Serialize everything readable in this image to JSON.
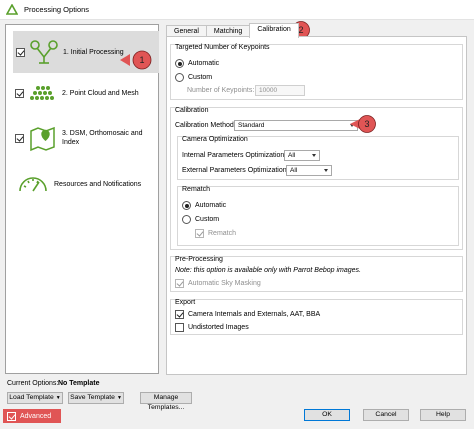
{
  "window": {
    "title": "Processing Options"
  },
  "steps": [
    {
      "label": "1. Initial Processing",
      "checked": true,
      "icon": "drone-camera-icon"
    },
    {
      "label": "2. Point Cloud and Mesh",
      "checked": true,
      "icon": "point-cloud-icon"
    },
    {
      "label": "3. DSM, Orthomosaic and Index",
      "checked": true,
      "icon": "map-pin-icon"
    },
    {
      "label": "Resources and Notifications",
      "checked": false,
      "icon": "gauge-icon"
    }
  ],
  "tabs": [
    {
      "label": "General",
      "active": false
    },
    {
      "label": "Matching",
      "active": false
    },
    {
      "label": "Calibration",
      "active": true
    }
  ],
  "keypoints": {
    "title": "Targeted Number of Keypoints",
    "automatic_label": "Automatic",
    "custom_label": "Custom",
    "selected": "Automatic",
    "number_label": "Number of Keypoints:",
    "number_value": "10000"
  },
  "calibration": {
    "title": "Calibration",
    "method_label": "Calibration Method",
    "method_value": "Standard",
    "camera_opt_title": "Camera Optimization",
    "internal_label": "Internal Parameters Optimization:",
    "internal_value": "All",
    "external_label": "External Parameters Optimization:",
    "external_value": "All",
    "rematch_title": "Rematch",
    "rematch_automatic": "Automatic",
    "rematch_custom": "Custom",
    "rematch_selected": "Automatic",
    "rematch_checkbox": "Rematch"
  },
  "preprocessing": {
    "title": "Pre-Processing",
    "note": "Note: this option is available only with Parrot Bebop images.",
    "sky_masking": "Automatic Sky Masking"
  },
  "export": {
    "title": "Export",
    "camera_internals": "Camera Internals and Externals, AAT, BBA",
    "camera_internals_checked": true,
    "undistorted": "Undistorted Images",
    "undistorted_checked": false
  },
  "bottom": {
    "current_options_label": "Current Options:",
    "current_options_value": "No Template",
    "load_template": "Load Template",
    "save_template": "Save Template",
    "manage_templates": "Manage Templates...",
    "ok": "OK",
    "cancel": "Cancel",
    "help": "Help",
    "advanced": "Advanced"
  },
  "callouts": [
    "1",
    "2",
    "3"
  ],
  "colors": {
    "callout": "#e05555",
    "selection": "#dcdcdc"
  }
}
